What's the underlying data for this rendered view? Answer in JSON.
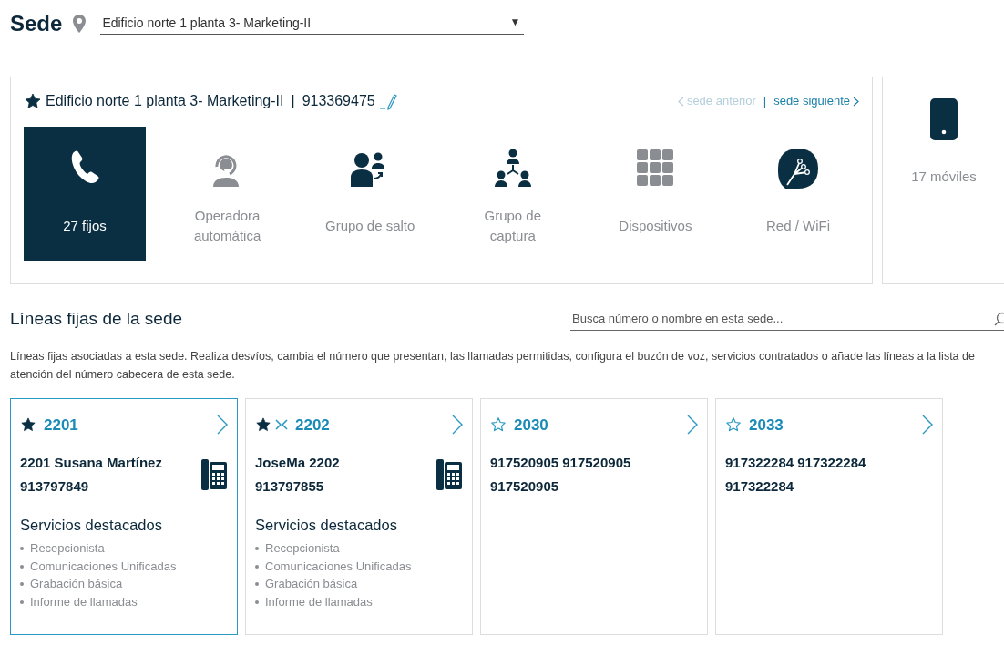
{
  "header": {
    "title": "Sede",
    "location": "Edificio norte 1 planta 3- Marketing-II",
    "dropdown_arrow": "▼"
  },
  "site_panel": {
    "name": "Edificio norte 1 planta 3- Marketing-II",
    "separator": "|",
    "phone": "913369475",
    "favorite": true,
    "nav": [
      {
        "label": "sede anterior",
        "disabled": true,
        "kind": "prev"
      },
      {
        "label": "sede siguiente",
        "disabled": false,
        "kind": "next"
      }
    ],
    "nav_separator": "|",
    "tiles": [
      {
        "kind": "phone",
        "label": "27 fijos",
        "selected": true,
        "disabled": false
      },
      {
        "kind": "operator",
        "label": "Operadora automática",
        "selected": false,
        "disabled": true
      },
      {
        "kind": "hunt",
        "label": "Grupo de salto",
        "selected": false,
        "disabled": false
      },
      {
        "kind": "pickup",
        "label": "Grupo de captura",
        "selected": false,
        "disabled": false
      },
      {
        "kind": "devices",
        "label": "Dispositivos",
        "selected": false,
        "disabled": true
      },
      {
        "kind": "network",
        "label": "Red / WiFi",
        "selected": false,
        "disabled": false
      }
    ]
  },
  "mobile_panel": {
    "label": "17 móviles"
  },
  "lines_section": {
    "title": "Líneas fijas de la sede",
    "search": {
      "placeholder": "Busca número o nombre en esta sede..."
    },
    "description": "Líneas fijas asociadas a esta sede. Realiza desvíos, cambia el número que presentan, las llamadas permitidas, configura el buzón de voz, servicios contratados o añade las líneas a la lista de atención del número cabecera de esta sede."
  },
  "line_cards": [
    {
      "extension": "2201",
      "favorite": true,
      "forwarded": false,
      "selected": true,
      "name": "2201 Susana Martínez",
      "number": "913797849",
      "desk_phone": true,
      "services_title": "Servicios destacados",
      "services": [
        "Recepcionista",
        "Comunicaciones Unificadas",
        "Grabación básica",
        "Informe de llamadas"
      ]
    },
    {
      "extension": "2202",
      "favorite": true,
      "forwarded": true,
      "selected": false,
      "name": "JoseMa 2202",
      "number": "913797855",
      "desk_phone": true,
      "services_title": "Servicios destacados",
      "services": [
        "Recepcionista",
        "Comunicaciones Unificadas",
        "Grabación básica",
        "Informe de llamadas"
      ]
    },
    {
      "extension": "2030",
      "favorite": false,
      "forwarded": false,
      "selected": false,
      "numbers": "917520905 917520905 917520905"
    },
    {
      "extension": "2033",
      "favorite": false,
      "forwarded": false,
      "selected": false,
      "numbers": "917322284 917322284 917322284"
    }
  ]
}
